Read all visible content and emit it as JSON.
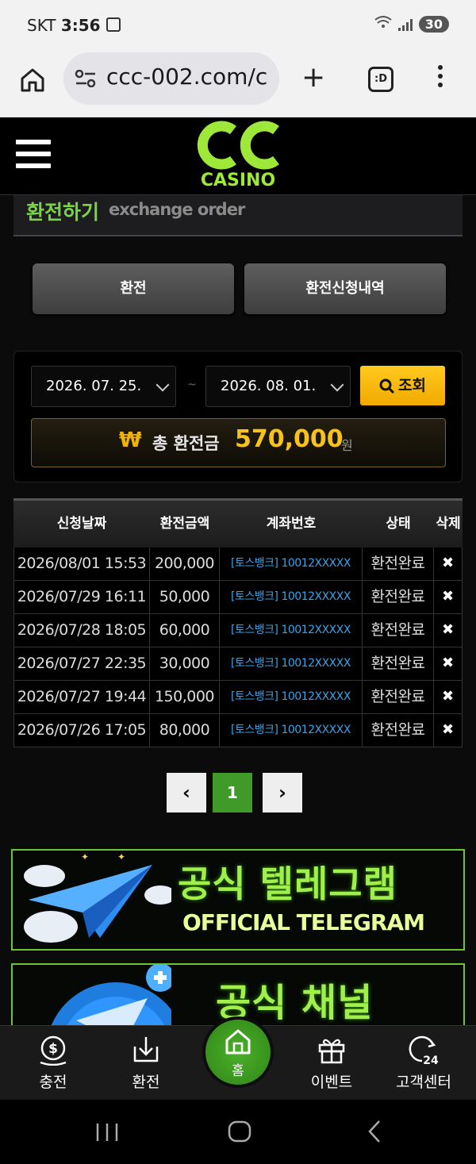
{
  "status_bar": {
    "carrier": "SKT",
    "time": "3:56",
    "battery": "30"
  },
  "browser": {
    "url": "ccc-002.com/c",
    "tabs_icon_text": ":D"
  },
  "site": {
    "logo_text": "CASINO"
  },
  "page": {
    "title_ko": "환전하기",
    "title_en": "exchange order"
  },
  "tabs": [
    {
      "label": "환전"
    },
    {
      "label": "환전신청내역"
    }
  ],
  "search": {
    "start_date": "2026. 07. 25.",
    "separator": "~",
    "end_date": "2026. 08. 01.",
    "button_label": "조회"
  },
  "total": {
    "currency_symbol": "₩",
    "label": "총 환전금",
    "amount": "570,000",
    "unit": "원"
  },
  "table": {
    "headers": [
      "신청날짜",
      "환전금액",
      "계좌번호",
      "상태",
      "삭제"
    ],
    "rows": [
      {
        "date": "2026/08/01 15:53",
        "amount": "200,000",
        "account": "[토스뱅크] 10012XXXXX",
        "status": "환전완료",
        "delete": "✖"
      },
      {
        "date": "2026/07/29 16:11",
        "amount": "50,000",
        "account": "[토스뱅크] 10012XXXXX",
        "status": "환전완료",
        "delete": "✖"
      },
      {
        "date": "2026/07/28 18:05",
        "amount": "60,000",
        "account": "[토스뱅크] 10012XXXXX",
        "status": "환전완료",
        "delete": "✖"
      },
      {
        "date": "2026/07/27 22:35",
        "amount": "30,000",
        "account": "[토스뱅크] 10012XXXXX",
        "status": "환전완료",
        "delete": "✖"
      },
      {
        "date": "2026/07/27 19:44",
        "amount": "150,000",
        "account": "[토스뱅크] 10012XXXXX",
        "status": "환전완료",
        "delete": "✖"
      },
      {
        "date": "2026/07/26 17:05",
        "amount": "80,000",
        "account": "[토스뱅크] 10012XXXXX",
        "status": "환전완료",
        "delete": "✖"
      }
    ]
  },
  "pagination": {
    "prev": "‹",
    "current": "1",
    "next": "›"
  },
  "banners": {
    "telegram": {
      "title": "공식 텔레그램",
      "subtitle": "OFFICIAL TELEGRAM"
    },
    "channel": {
      "title": "공식 채널"
    }
  },
  "bottom_nav": {
    "items": [
      {
        "label": "충전",
        "icon": "dollar-coin-icon"
      },
      {
        "label": "환전",
        "icon": "download-tray-icon"
      },
      {
        "label": "홈",
        "icon": "home-icon"
      },
      {
        "label": "이벤트",
        "icon": "gift-icon"
      },
      {
        "label": "고객센터",
        "icon": "support-24-icon"
      }
    ]
  },
  "colors": {
    "accent_green": "#7bd34a",
    "accent_gold": "#f7c21a",
    "link_blue": "#3aa2e6"
  }
}
